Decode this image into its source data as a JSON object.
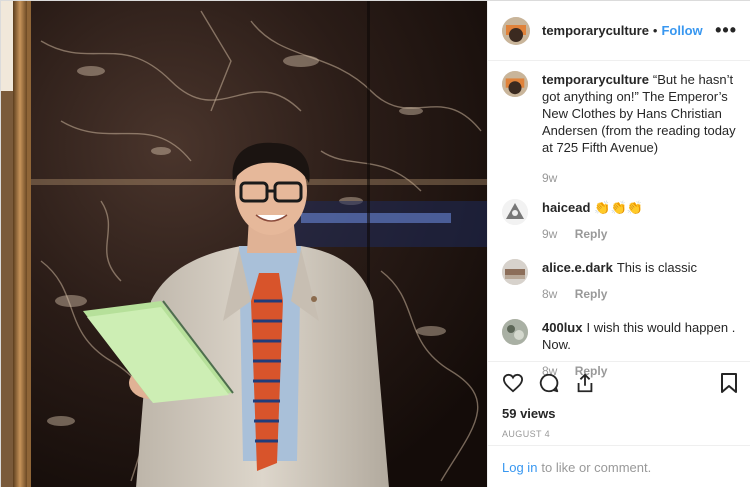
{
  "post": {
    "username": "temporaryculture",
    "separator": "•",
    "follow_label": "Follow",
    "more_label": "•••"
  },
  "caption": {
    "username": "temporaryculture",
    "text": "“But he hasn’t got anything on!” The Emperor’s New Clothes by Hans Christian Andersen (from the reading today at 725 Fifth Avenue)",
    "time": "9w"
  },
  "comments": [
    {
      "username": "haicead",
      "text": "👏👏👏",
      "time": "9w",
      "reply_label": "Reply"
    },
    {
      "username": "alice.e.dark",
      "text": "This is classic",
      "time": "8w",
      "reply_label": "Reply"
    },
    {
      "username": "400lux",
      "text": "I wish this would happen . Now.",
      "time": "8w",
      "reply_label": "Reply"
    }
  ],
  "stats": {
    "views": "59 views",
    "date": "AUGUST 4"
  },
  "login": {
    "link_label": "Log in",
    "suffix": "to like or comment."
  },
  "icons": {
    "like": "heart-icon",
    "comment": "comment-bubble-icon",
    "share": "share-icon",
    "save": "bookmark-icon",
    "more": "more-options-icon"
  },
  "colors": {
    "accent": "#3897f0",
    "text": "#262626",
    "muted": "#999999"
  }
}
